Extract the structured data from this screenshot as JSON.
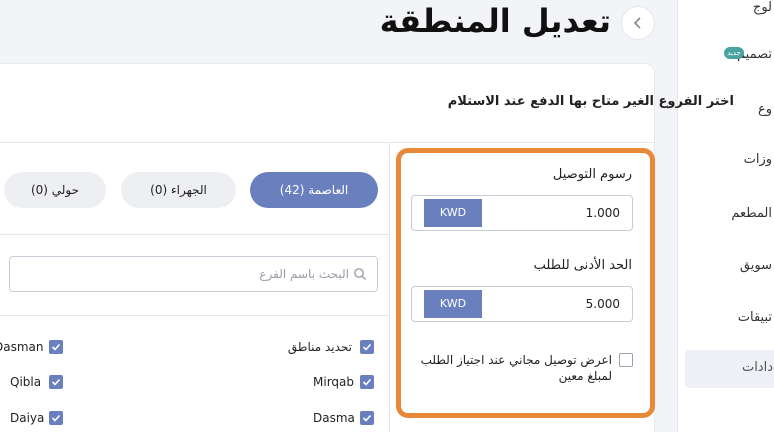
{
  "sidebar": {
    "items": [
      {
        "label": "لوج"
      },
      {
        "label": "تصميم",
        "badge": "جديد"
      },
      {
        "label": "وع"
      },
      {
        "label": "وزات"
      },
      {
        "label": "المطعم"
      },
      {
        "label": "سويق"
      },
      {
        "label": "تبيقات"
      },
      {
        "label": "دادات"
      }
    ]
  },
  "header": {
    "title": "تعديل المنطقة",
    "back_icon": "chevron-left-icon"
  },
  "instruction": "اختر الفروع الغير متاح بها الدفع عند الاستلام",
  "delivery": {
    "fee_label": "رسوم التوصيل",
    "fee_currency": "KWD",
    "fee_value": "1.000",
    "min_label": "الحد الأدنى للطلب",
    "min_currency": "KWD",
    "min_value": "5.000",
    "free_delivery_label": "اعرض توصيل مجاني عند اجتياز الطلب لمبلغ معين",
    "free_delivery_checked": false
  },
  "regions": {
    "tabs": [
      {
        "label": "العاصمة (42)",
        "active": true
      },
      {
        "label": "الجهراء (0)",
        "active": false
      },
      {
        "label": "حولي (0)",
        "active": false
      }
    ],
    "search_placeholder": "البحث باسم الفرع",
    "branches": [
      {
        "label": "تحديد مناطق",
        "checked": true
      },
      {
        "label": "Dasman",
        "checked": true
      },
      {
        "label": "Mirqab",
        "checked": true
      },
      {
        "label": "Qibla",
        "checked": true
      },
      {
        "label": "Dasma",
        "checked": true
      },
      {
        "label": "Daiya",
        "checked": true
      }
    ]
  },
  "colors": {
    "accent": "#6a80be",
    "highlight": "#e8893a",
    "badge": "#4aa3a2"
  }
}
